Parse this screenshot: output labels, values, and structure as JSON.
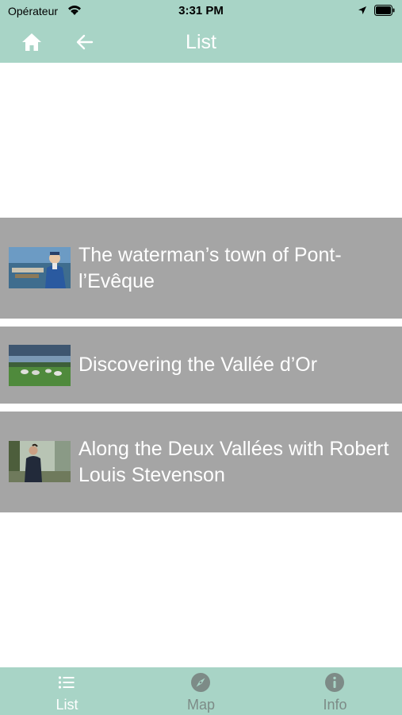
{
  "status_bar": {
    "carrier": "Opérateur",
    "time": "3:31 PM"
  },
  "nav": {
    "title": "List",
    "home_icon": "home-icon",
    "back_icon": "arrow-left-icon"
  },
  "items": [
    {
      "title": "The waterman’s town of Pont-l’Evêque"
    },
    {
      "title": "Discovering the Vallée d’Or"
    },
    {
      "title": "Along the Deux Vallées with Robert Louis Stevenson"
    }
  ],
  "tabs": [
    {
      "label": "List",
      "icon": "list-icon",
      "active": true
    },
    {
      "label": "Map",
      "icon": "compass-icon",
      "active": false
    },
    {
      "label": "Info",
      "icon": "info-icon",
      "active": false
    }
  ],
  "colors": {
    "header_bg": "#a8d4c6",
    "item_bg": "#a5a5a5",
    "inactive_tab": "#7d8b87"
  }
}
